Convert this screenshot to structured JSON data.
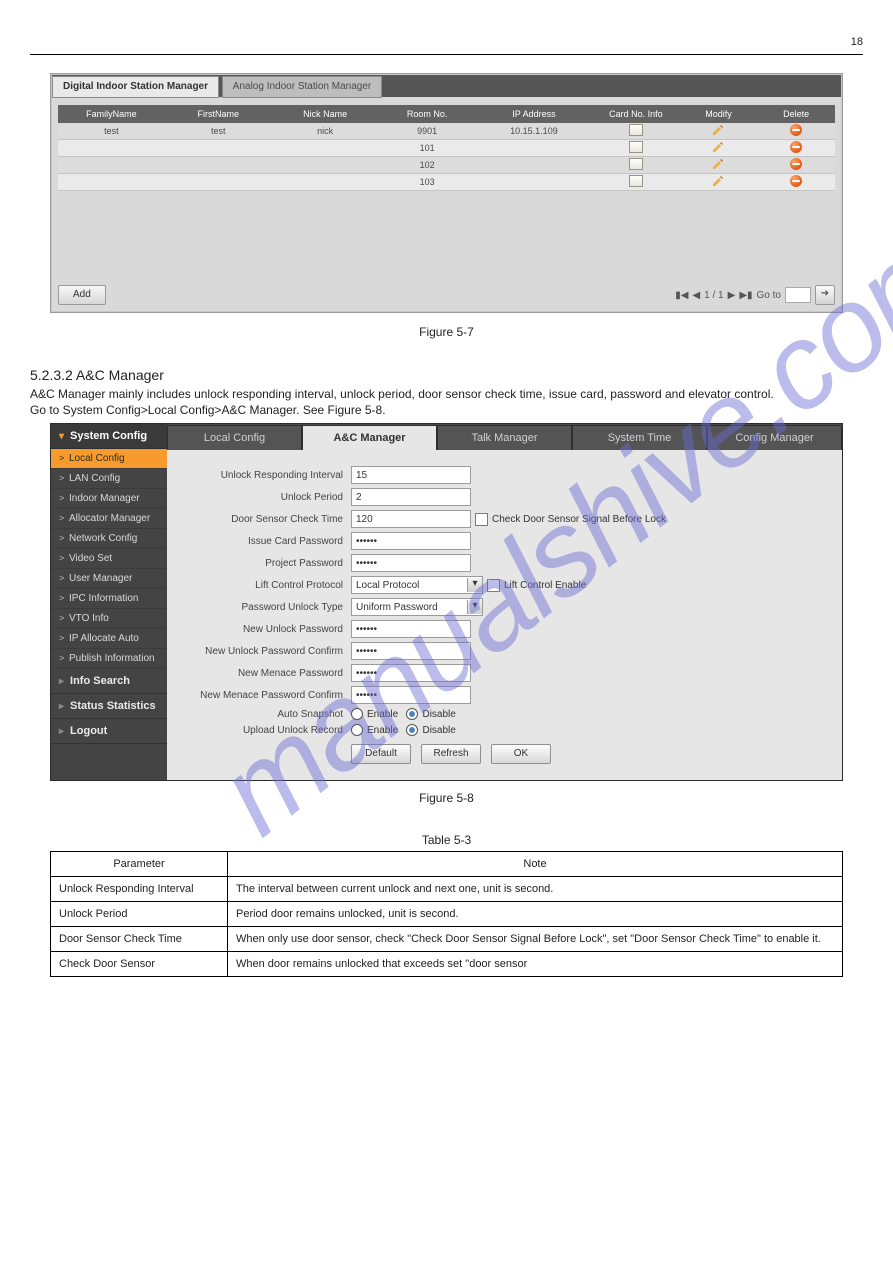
{
  "page": {
    "number": "18",
    "watermark": "manualshive.com"
  },
  "fig1": {
    "tabs": [
      "Digital Indoor Station Manager",
      "Analog Indoor Station Manager"
    ],
    "columns": [
      "FamilyName",
      "FirstName",
      "Nick Name",
      "Room No.",
      "IP Address",
      "Card No. Info",
      "Modify",
      "Delete"
    ],
    "rows": [
      {
        "family": "test",
        "first": "test",
        "nick": "nick",
        "room": "9901",
        "ip": "10.15.1.109"
      },
      {
        "room": "101"
      },
      {
        "room": "102"
      },
      {
        "room": "103"
      }
    ],
    "add_label": "Add",
    "pager": {
      "position": "1 / 1",
      "goto_label": "Go to"
    },
    "caption": "Figure 5-7"
  },
  "section": {
    "heading": "5.2.3.2 A&C Manager",
    "text1": "A&C Manager mainly includes unlock responding interval, unlock period, door sensor check time, issue card, password and elevator control.",
    "text2": "Go to System Config>Local Config>A&C Manager. See Figure 5-8."
  },
  "fig2": {
    "sidebar": {
      "header": "System Config",
      "items": [
        "Local Config",
        "LAN Config",
        "Indoor Manager",
        "Allocator Manager",
        "Network Config",
        "Video Set",
        "User Manager",
        "IPC Information",
        "VTO Info",
        "IP Allocate Auto",
        "Publish Information"
      ],
      "groups": [
        "Info Search",
        "Status Statistics",
        "Logout"
      ]
    },
    "tabs": [
      "Local Config",
      "A&C Manager",
      "Talk Manager",
      "System Time",
      "Config Manager"
    ],
    "form": {
      "unlock_interval": {
        "label": "Unlock Responding Interval",
        "value": "15"
      },
      "unlock_period": {
        "label": "Unlock Period",
        "value": "2"
      },
      "door_sensor": {
        "label": "Door Sensor Check Time",
        "value": "120",
        "checkbox": "Check Door Sensor Signal Before Lock"
      },
      "issue_card_pw": {
        "label": "Issue Card Password",
        "value": "••••••"
      },
      "project_pw": {
        "label": "Project Password",
        "value": "••••••"
      },
      "lift_protocol": {
        "label": "Lift Control Protocol",
        "value": "Local Protocol",
        "checkbox": "Lift Control Enable"
      },
      "pw_unlock_type": {
        "label": "Password Unlock Type",
        "value": "Uniform Password"
      },
      "new_unlock_pw": {
        "label": "New Unlock Password",
        "value": "••••••"
      },
      "new_unlock_pw_confirm": {
        "label": "New Unlock Password Confirm",
        "value": "••••••"
      },
      "menace_pw": {
        "label": "New Menace Password",
        "value": "••••••"
      },
      "menace_pw_confirm": {
        "label": "New Menace Password Confirm",
        "value": "••••••"
      },
      "auto_snapshot": {
        "label": "Auto Snapshot"
      },
      "upload_unlock": {
        "label": "Upload Unlock Record"
      },
      "radio": {
        "enable": "Enable",
        "disable": "Disable"
      }
    },
    "buttons": {
      "default": "Default",
      "refresh": "Refresh",
      "ok": "OK"
    },
    "caption": "Figure 5-8"
  },
  "ptab": {
    "caption": "Table 5-3",
    "headers": [
      "Parameter",
      "Note"
    ],
    "rows": [
      {
        "p": "Unlock Responding Interval",
        "n": "The interval between current unlock and next one, unit is second."
      },
      {
        "p": "Unlock Period",
        "n": "Period door remains unlocked, unit is second."
      },
      {
        "p": "Door Sensor Check Time",
        "n": "When only use door sensor, check \"Check Door Sensor Signal Before Lock\", set \"Door Sensor Check Time\" to enable it."
      },
      {
        "p": "Check Door Sensor",
        "n": "When door remains unlocked that exceeds set \"door sensor"
      }
    ]
  }
}
